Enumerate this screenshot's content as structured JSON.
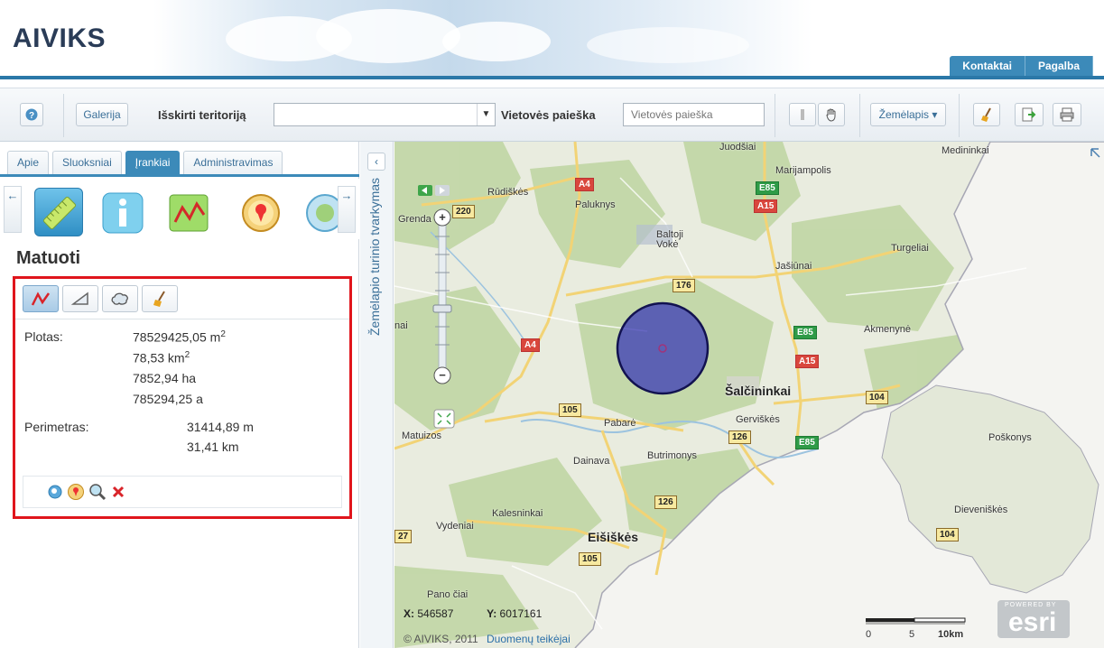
{
  "app": {
    "logo": "AIVIKS"
  },
  "header": {
    "tabs": [
      {
        "label": "Kontaktai"
      },
      {
        "label": "Pagalba"
      }
    ]
  },
  "toolbar": {
    "help_icon": "help-icon",
    "gallery_label": "Galerija",
    "territory_label": "Išskirti teritoriją",
    "territory_value": "",
    "search_label": "Vietovės paieška",
    "search_placeholder": "Vietovės paieška",
    "map_dropdown_label": "Žemėlapis ▾"
  },
  "left_panel": {
    "tabs": [
      {
        "label": "Apie"
      },
      {
        "label": "Sluoksniai"
      },
      {
        "label": "Įrankiai",
        "active": true
      },
      {
        "label": "Administravimas"
      }
    ],
    "title": "Matuoti",
    "measurements": {
      "area_label": "Plotas:",
      "area_m2": "78529425,05 m",
      "area_km2": "78,53 km",
      "area_ha": "7852,94 ha",
      "area_a": "785294,25 a",
      "perimeter_label": "Perimetras:",
      "perimeter_m": "31414,89 m",
      "perimeter_km": "31,41 km",
      "sup": "2"
    }
  },
  "rail": {
    "label": "Žemėlapio turinio tvarkymas",
    "collapse_glyph": "‹"
  },
  "map": {
    "places": [
      {
        "name": "Rūdiškės"
      },
      {
        "name": "Paluknys"
      },
      {
        "name": "Juodšiai"
      },
      {
        "name": "Marijampolis"
      },
      {
        "name": "Medininkai"
      },
      {
        "name": "Grenda"
      },
      {
        "name": "Baltoji Vokė"
      },
      {
        "name": "Jašiūnai"
      },
      {
        "name": "Turgeliai"
      },
      {
        "name": "Akmenynė"
      },
      {
        "name": "Šalčininkai"
      },
      {
        "name": "Gerviškės"
      },
      {
        "name": "Pabarė"
      },
      {
        "name": "Matuizos"
      },
      {
        "name": "Dainava"
      },
      {
        "name": "Butrimonys"
      },
      {
        "name": "Poškonys"
      },
      {
        "name": "Kalesninkai"
      },
      {
        "name": "Vydeniai"
      },
      {
        "name": "Eišiškės"
      },
      {
        "name": "Dieveniškės"
      },
      {
        "name": "Pano čiai"
      },
      {
        "name": "nai"
      }
    ],
    "roads": [
      "220",
      "A4",
      "E85",
      "A15",
      "176",
      "E85",
      "A15",
      "A4",
      "105",
      "126",
      "E85",
      "104",
      "126",
      "105",
      "104",
      "27"
    ],
    "coord_x_label": "X:",
    "coord_x": "546587",
    "coord_y_label": "Y:",
    "coord_y": "6017161",
    "copyright": "© AIVIKS, 2011",
    "data_providers": "Duomenų teikėjai",
    "scale": {
      "labels": [
        "0",
        "5",
        "10km"
      ]
    },
    "esri_small": "POWERED BY",
    "esri": "esri"
  }
}
